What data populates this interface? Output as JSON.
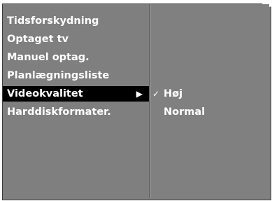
{
  "menu": {
    "items": [
      {
        "label": "Tidsforskydning"
      },
      {
        "label": "Optaget tv"
      },
      {
        "label": "Manuel optag."
      },
      {
        "label": "Planlægningsliste"
      },
      {
        "label": "Videokvalitet",
        "arrow": "▶"
      },
      {
        "label": "Harddiskformater."
      }
    ],
    "selected_index": 4
  },
  "submenu": {
    "check_glyph": "✓",
    "items": [
      {
        "label": "Høj"
      },
      {
        "label": "Normal"
      }
    ],
    "checked_index": 0
  },
  "icons": {
    "submenu_arrow": "right-triangle-icon",
    "checkmark": "checkmark-icon"
  },
  "colors": {
    "panel": "#808080",
    "highlight": "#000000",
    "text": "#ffffff"
  }
}
